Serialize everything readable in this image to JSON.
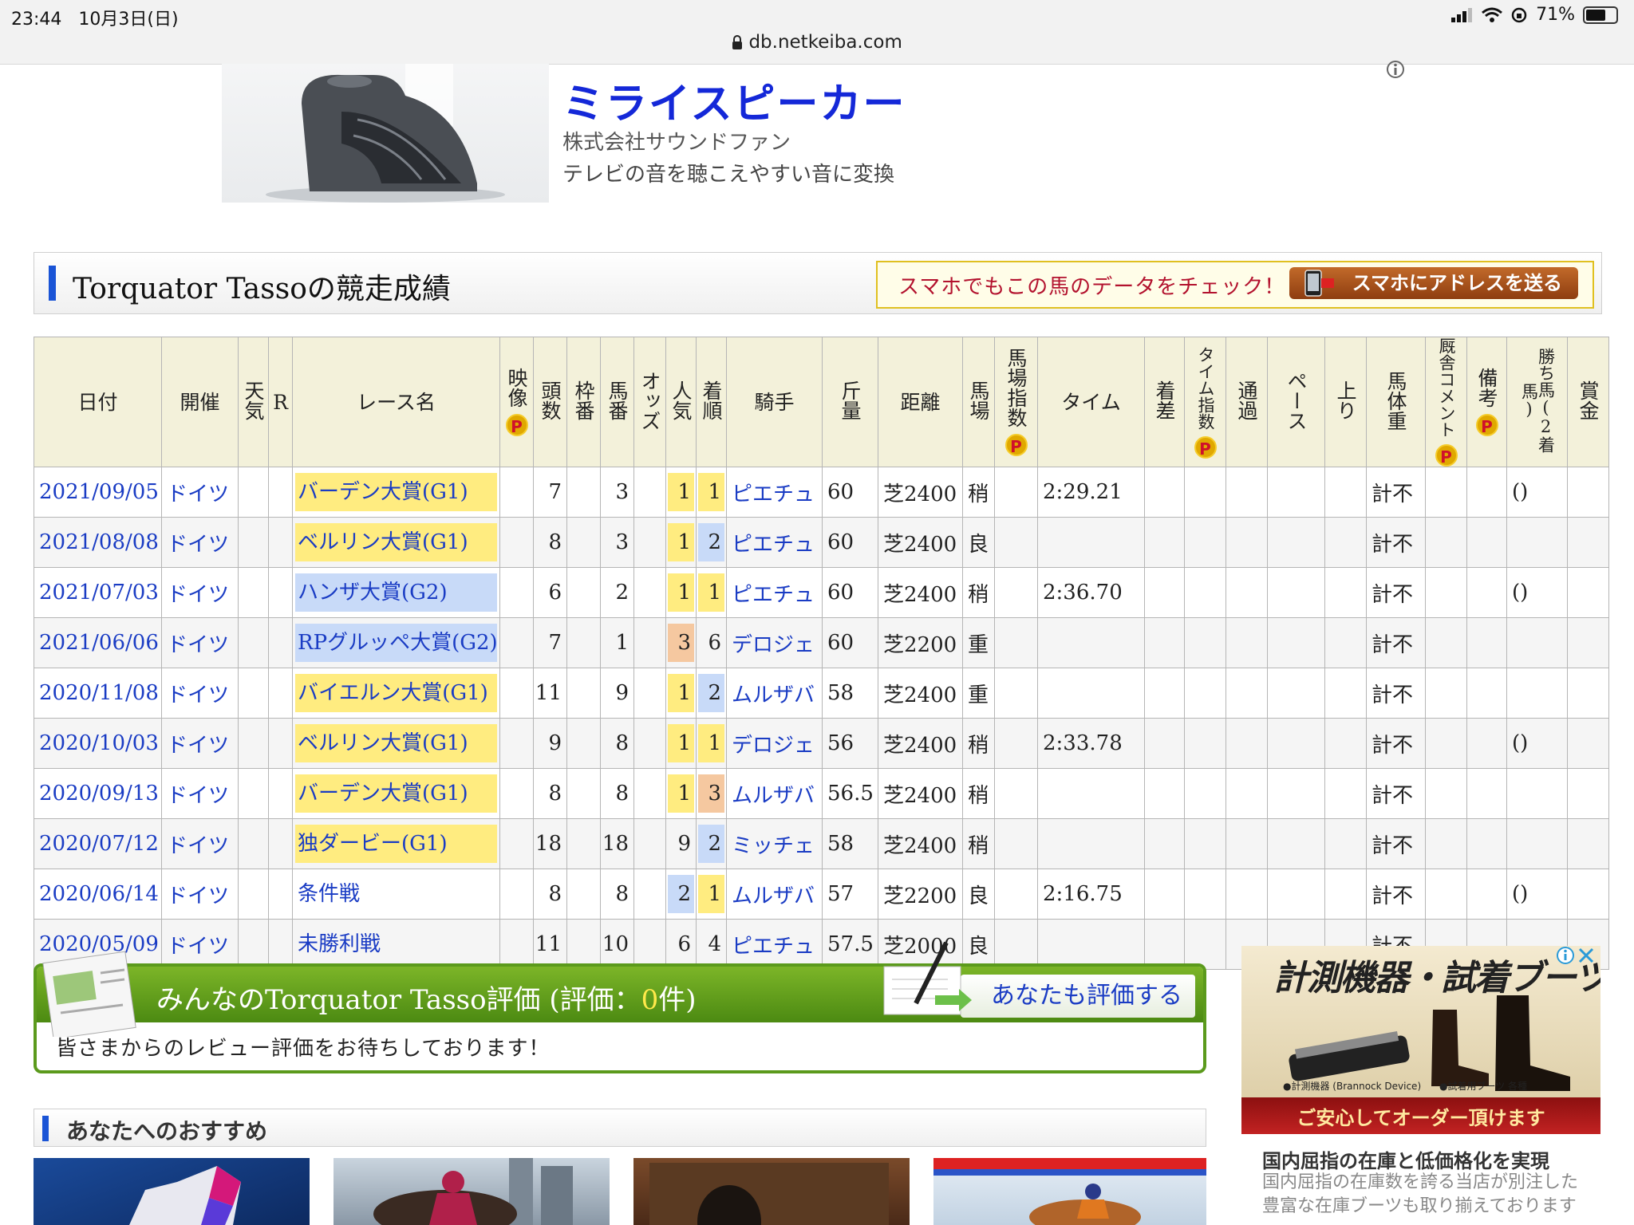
{
  "status_bar": {
    "time": "23:44",
    "date": "10月3日(日)",
    "battery": "71%",
    "battery_level": 0.71
  },
  "browser": {
    "url": "db.netkeiba.com"
  },
  "ad_top": {
    "title": "ミライスピーカー",
    "company": "株式会社サウンドファン",
    "description": "テレビの音を聴こえやすい音に変換"
  },
  "race_section": {
    "title": "Torquator Tassoの競走成績",
    "smartphone_text": "スマホでもこの馬のデータをチェック！",
    "smartphone_button": "スマホにアドレスを送る"
  },
  "table": {
    "headers": {
      "date": "日付",
      "venue": "開催",
      "weather": "天気",
      "r": "R",
      "race_name": "レース名",
      "video": "映像",
      "heads": "頭数",
      "frame": "枠番",
      "horse_no": "馬番",
      "odds": "オッズ",
      "popularity": "人気",
      "finish": "着順",
      "jockey": "騎手",
      "weight": "斤量",
      "distance": "距離",
      "track": "馬場",
      "track_index": "馬場指数",
      "time": "タイム",
      "margin": "着差",
      "time_index": "タイム指数",
      "passing": "通過",
      "pace": "ペース",
      "last3f": "上り",
      "body_weight": "馬体重",
      "stable_comment": "厩舎コメント",
      "remarks": "備考",
      "winner": "勝ち馬(2着馬)",
      "prize": "賞金",
      "p_badge": "P"
    },
    "rows": [
      {
        "date": "2021/09/05",
        "venue": "ドイツ",
        "race": "バーデン大賞(G1)",
        "grade": "g1",
        "heads": "7",
        "frame": "",
        "horse_no": "3",
        "popularity": "1",
        "finish": "1",
        "jockey": "ピエチュ",
        "weight": "60",
        "distance": "芝2400",
        "track": "稍",
        "time": "2:29.21",
        "body_weight": "計不",
        "winner": "()"
      },
      {
        "date": "2021/08/08",
        "venue": "ドイツ",
        "race": "ベルリン大賞(G1)",
        "grade": "g1",
        "heads": "8",
        "frame": "",
        "horse_no": "3",
        "popularity": "1",
        "finish": "2",
        "jockey": "ピエチュ",
        "weight": "60",
        "distance": "芝2400",
        "track": "良",
        "time": "",
        "body_weight": "計不",
        "winner": ""
      },
      {
        "date": "2021/07/03",
        "venue": "ドイツ",
        "race": "ハンザ大賞(G2)",
        "grade": "g2",
        "heads": "6",
        "frame": "",
        "horse_no": "2",
        "popularity": "1",
        "finish": "1",
        "jockey": "ピエチュ",
        "weight": "60",
        "distance": "芝2400",
        "track": "稍",
        "time": "2:36.70",
        "body_weight": "計不",
        "winner": "()"
      },
      {
        "date": "2021/06/06",
        "venue": "ドイツ",
        "race": "RPグルッペ大賞(G2)",
        "grade": "g2",
        "heads": "7",
        "frame": "",
        "horse_no": "1",
        "popularity": "3",
        "finish": "6",
        "jockey": "デロジェ",
        "weight": "60",
        "distance": "芝2200",
        "track": "重",
        "time": "",
        "body_weight": "計不",
        "winner": ""
      },
      {
        "date": "2020/11/08",
        "venue": "ドイツ",
        "race": "バイエルン大賞(G1)",
        "grade": "g1",
        "heads": "11",
        "frame": "",
        "horse_no": "9",
        "popularity": "1",
        "finish": "2",
        "jockey": "ムルザバ",
        "weight": "58",
        "distance": "芝2400",
        "track": "重",
        "time": "",
        "body_weight": "計不",
        "winner": ""
      },
      {
        "date": "2020/10/03",
        "venue": "ドイツ",
        "race": "ベルリン大賞(G1)",
        "grade": "g1",
        "heads": "9",
        "frame": "",
        "horse_no": "8",
        "popularity": "1",
        "finish": "1",
        "jockey": "デロジェ",
        "weight": "56",
        "distance": "芝2400",
        "track": "稍",
        "time": "2:33.78",
        "body_weight": "計不",
        "winner": "()"
      },
      {
        "date": "2020/09/13",
        "venue": "ドイツ",
        "race": "バーデン大賞(G1)",
        "grade": "g1",
        "heads": "8",
        "frame": "",
        "horse_no": "8",
        "popularity": "1",
        "finish": "3",
        "jockey": "ムルザバ",
        "weight": "56.5",
        "distance": "芝2400",
        "track": "稍",
        "time": "",
        "body_weight": "計不",
        "winner": ""
      },
      {
        "date": "2020/07/12",
        "venue": "ドイツ",
        "race": "独ダービー(G1)",
        "grade": "g1",
        "heads": "18",
        "frame": "",
        "horse_no": "18",
        "popularity": "9",
        "finish": "2",
        "jockey": "ミッチェ",
        "weight": "58",
        "distance": "芝2400",
        "track": "稍",
        "time": "",
        "body_weight": "計不",
        "winner": ""
      },
      {
        "date": "2020/06/14",
        "venue": "ドイツ",
        "race": "条件戦",
        "grade": "",
        "heads": "8",
        "frame": "",
        "horse_no": "8",
        "popularity": "2",
        "finish": "1",
        "jockey": "ムルザバ",
        "weight": "57",
        "distance": "芝2200",
        "track": "良",
        "time": "2:16.75",
        "body_weight": "計不",
        "winner": "()"
      },
      {
        "date": "2020/05/09",
        "venue": "ドイツ",
        "race": "未勝利戦",
        "grade": "",
        "heads": "11",
        "frame": "",
        "horse_no": "10",
        "popularity": "6",
        "finish": "4",
        "jockey": "ピエチュ",
        "weight": "57.5",
        "distance": "芝2000",
        "track": "良",
        "time": "",
        "body_weight": "計不",
        "winner": ""
      }
    ]
  },
  "review": {
    "title_prefix": "みんなのTorquator Tasso評価 (評価：",
    "count": "0",
    "title_suffix": "件)",
    "button": "あなたも評価する",
    "subtitle": "皆さまからのレビュー評価をお待ちしております！"
  },
  "recommendation": {
    "title": "あなたへのおすすめ"
  },
  "side_ad": {
    "image_title": "計測機器・試着ブーツ無料貸出",
    "label_1": "●計測機器 (Brannock Device)",
    "label_2": "●試着用ブーツ 各種",
    "band": "ご安心してオーダー頂けます",
    "headline": "国内屈指の在庫と低価格化を実現",
    "body": "国内屈指の在庫数を誇る当店が別注した豊富な在庫ブーツも取り揃えております"
  },
  "colors": {
    "link": "#1a3cc4",
    "grade1": "#ffec80",
    "grade2": "#c8daf8",
    "header_bg": "#f3f1da",
    "review_green": "#5b9a1c",
    "accent_bar": "#1a54d6"
  }
}
